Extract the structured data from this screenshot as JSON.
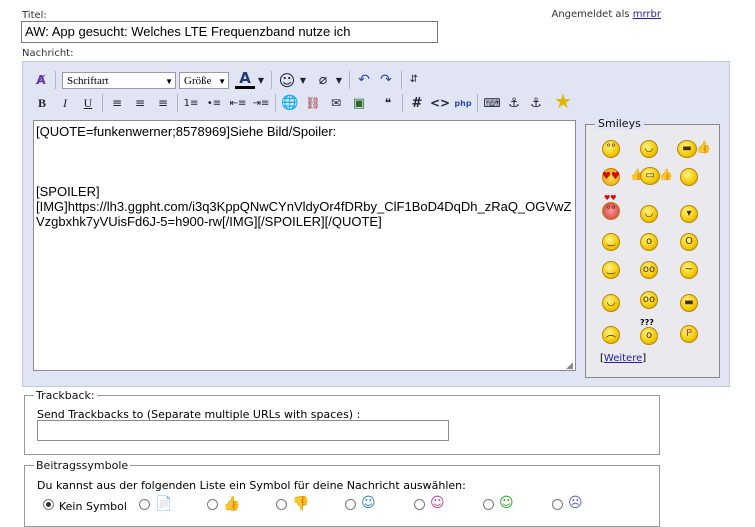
{
  "header": {
    "title_label": "Titel:",
    "title_value": "AW: App gesucht: Welches LTE Frequenzband nutze ich",
    "login_prefix": "Angemeldet als",
    "login_user": "mrrbr"
  },
  "editor": {
    "message_label": "Nachricht:",
    "font_select": "Schriftart",
    "size_select": "Größe",
    "content": "[QUOTE=funkenwerner;8578969]Siehe Bild/Spoiler:\n\n\n\n[SPOILER]\n[IMG]https://lh3.ggpht.com/i3q3KppQNwCYnVldyOr4fDRby_ClF1BoD4DqDh_zRaQ_OGVwZVzgbxhk7yVUisFd6J-5=h900-rw[/IMG][/SPOILER][/QUOTE]"
  },
  "smileys": {
    "legend": "Smileys",
    "more": "Weitere"
  },
  "trackback": {
    "legend": "Trackback:",
    "label": "Send Trackbacks to (Separate multiple URLs with spaces) :",
    "value": ""
  },
  "post_icons": {
    "legend": "Beitragssymbole",
    "description": "Du kannst aus der folgenden Liste ein Symbol für deine Nachricht auswählen:",
    "no_icon_label": "Kein Symbol"
  }
}
